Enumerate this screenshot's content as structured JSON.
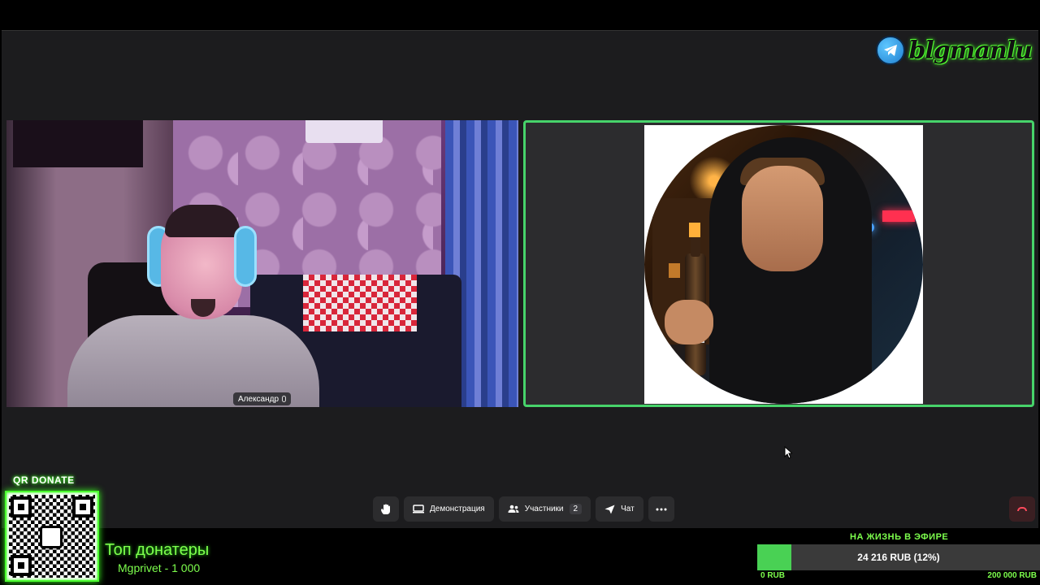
{
  "brand": {
    "name": "blgmanlu",
    "icon": "telegram-icon"
  },
  "participants": {
    "left": {
      "name": "Александр",
      "mic_icon": "mic-icon"
    }
  },
  "controls": {
    "raise_hand_icon": "hand-icon",
    "screen_share_label": "Демонстрация",
    "participants_label": "Участники",
    "participants_count": "2",
    "chat_label": "Чат",
    "more_icon": "more-icon",
    "end_call_icon": "end-call-icon"
  },
  "overlay": {
    "qr_label": "QR DONATE",
    "top_donors_title": "Топ донатеры",
    "top_donors": [
      "Mgprivet - 1 000"
    ],
    "goal": {
      "title": "НА ЖИЗНЬ В ЭФИРЕ",
      "progress_text": "24 216 RUB (12%)",
      "progress": 0.12,
      "min_label": "0 RUB",
      "max_label": "200 000 RUB"
    }
  },
  "colors": {
    "accent_green": "#47d36a",
    "neon_green": "#7dff4d",
    "end_call_red": "#ff4a5c"
  }
}
